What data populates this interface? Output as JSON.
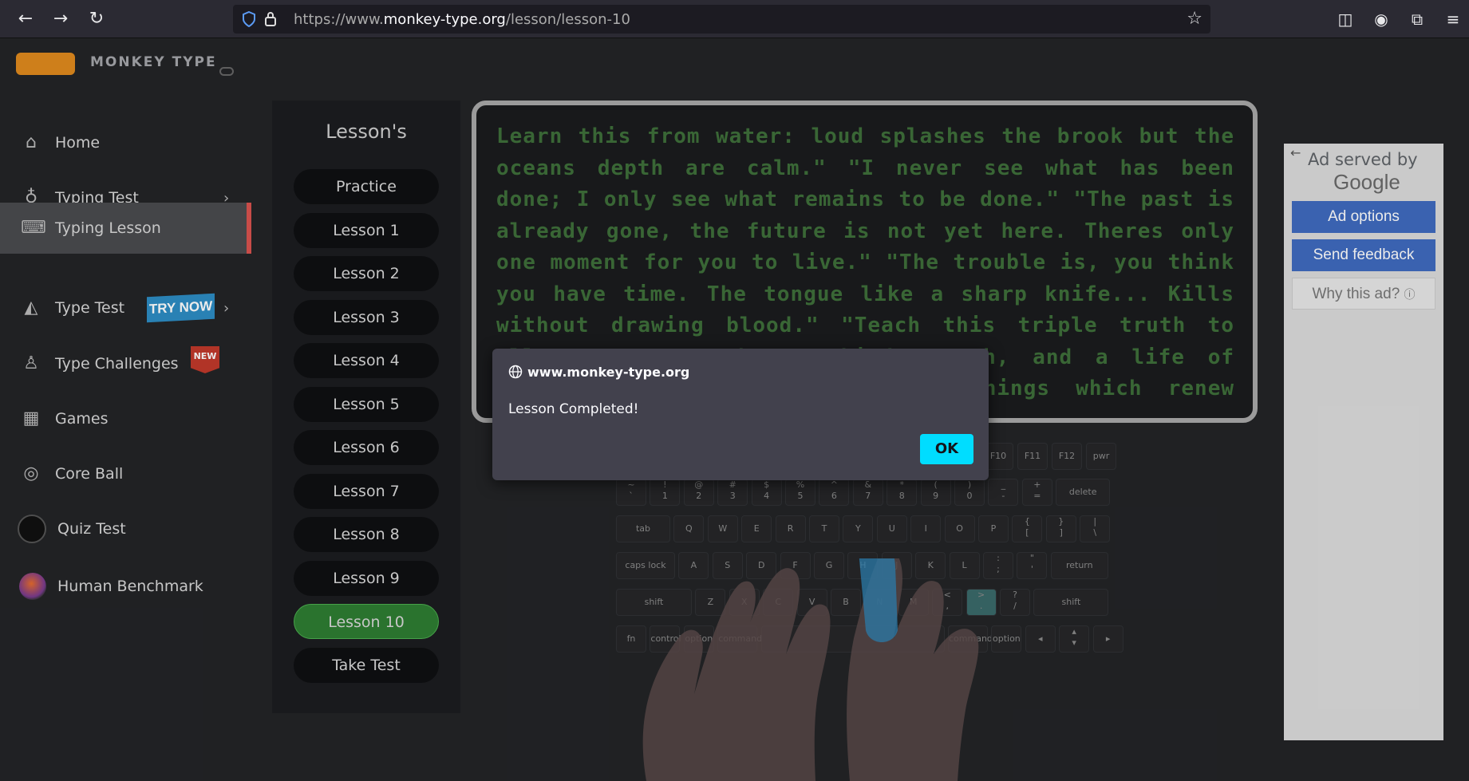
{
  "browser": {
    "url_prefix": "https://www.",
    "url_domain": "monkey-type.org",
    "url_path": "/lesson/lesson-10"
  },
  "sidebar": {
    "logo_text": "MONKEY TYPE",
    "items": [
      {
        "label": "Home",
        "icon": "home-icon"
      },
      {
        "label": "Typing Test",
        "icon": "github-icon"
      },
      {
        "label": "Typing Lesson",
        "icon": "keyboard-icon"
      },
      {
        "label": "Type Test",
        "icon": "gitlab-icon",
        "badge": "TRY NOW"
      },
      {
        "label": "Type Challenges",
        "icon": "award-icon",
        "badge": "NEW"
      },
      {
        "label": "Games",
        "icon": "grid-icon"
      },
      {
        "label": "Core Ball",
        "icon": "target-icon"
      },
      {
        "label": "Quiz Test",
        "icon": "avatar"
      },
      {
        "label": "Human Benchmark",
        "icon": "avatar"
      }
    ]
  },
  "lessons": {
    "title": "Lesson's",
    "items": [
      "Practice",
      "Lesson 1",
      "Lesson 2",
      "Lesson 3",
      "Lesson 4",
      "Lesson 5",
      "Lesson 6",
      "Lesson 7",
      "Lesson 8",
      "Lesson 9",
      "Lesson 10",
      "Take Test"
    ],
    "active": "Lesson 10"
  },
  "text": {
    "passage": "Learn this from water: loud splashes the brook but the oceans depth are calm.\" \"I never see what has been done; I only see what remains to be done.\" \"The past is already gone, the future is not yet here. Theres only one moment for you to live.\" \"The trouble is, you think you have time. The tongue like a sharp knife... Kills without drawing blood.\" \"Teach this triple truth to all: A generous heart, kind speech, and a life of service and compassion are the things which renew humanity",
    "end": "."
  },
  "ad": {
    "served_by": "Ad served by",
    "google": "Google",
    "options": "Ad options",
    "feedback": "Send feedback",
    "why": "Why this ad?"
  },
  "dialog": {
    "origin": "www.monkey-type.org",
    "message": "Lesson Completed!",
    "ok": "OK"
  },
  "keyboard": {
    "row0": [
      "F10",
      "F11",
      "F12",
      "pwr"
    ],
    "row1": [
      "~\n`",
      "!\n1",
      "@\n2",
      "#\n3",
      "$\n4",
      "%\n5",
      "^\n6",
      "&\n7",
      "*\n8",
      "(\n9",
      ")\n0",
      "_\n-",
      "+\n=",
      "delete"
    ],
    "row2": [
      "tab",
      "Q",
      "W",
      "E",
      "R",
      "T",
      "Y",
      "U",
      "I",
      "O",
      "P",
      "{\n[",
      "}\n]",
      "|\n\\"
    ],
    "row3": [
      "caps lock",
      "A",
      "S",
      "D",
      "F",
      "G",
      "H",
      "J",
      "K",
      "L",
      ":\n;",
      "\"\n'",
      "return"
    ],
    "row4": [
      "shift",
      "Z",
      "X",
      "C",
      "V",
      "B",
      "N",
      "M",
      "<\n,",
      ">\n.",
      "?\n/",
      "shift"
    ],
    "row5": [
      "fn",
      "control",
      "option",
      "command",
      "command",
      "option",
      "◂",
      "▴\n▾",
      "▸"
    ]
  }
}
